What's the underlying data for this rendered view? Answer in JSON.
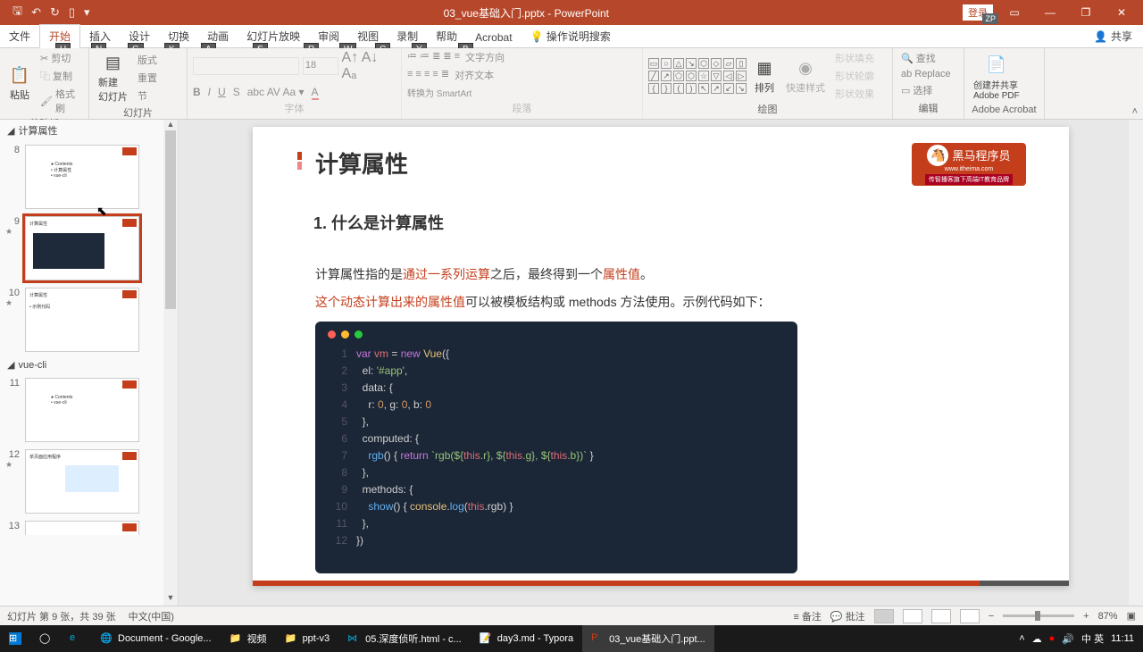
{
  "titlebar": {
    "title": "03_vue基础入门.pptx - PowerPoint",
    "login": "登录",
    "zp": "ZP"
  },
  "tabs": {
    "file": "文件",
    "home": "开始",
    "insert": "插入",
    "design": "设计",
    "transitions": "切换",
    "animations": "动画",
    "slideshow": "幻灯片放映",
    "review": "审阅",
    "view": "视图",
    "record": "录制",
    "help": "帮助",
    "acrobat": "Acrobat",
    "tellme": "操作说明搜索",
    "share": "共享"
  },
  "keytips": {
    "home": "H",
    "insert": "N",
    "design": "G",
    "transitions": "K",
    "animations": "A",
    "slideshow": "S",
    "review": "R",
    "view": "W",
    "record": "C",
    "help": "Y",
    "acrobat": "B"
  },
  "ribbon": {
    "clipboard": {
      "label": "剪贴板",
      "paste": "粘贴",
      "cut": "剪切",
      "copy": "复制",
      "format": "格式刷"
    },
    "slides": {
      "label": "幻灯片",
      "new": "新建\n幻灯片",
      "layout": "版式",
      "reset": "重置",
      "section": "节"
    },
    "font": {
      "label": "字体",
      "size": "18"
    },
    "paragraph": {
      "label": "段落",
      "textdir": "文字方向",
      "align": "对齐文本",
      "smartart": "转换为 SmartArt"
    },
    "drawing": {
      "label": "绘图",
      "arrange": "排列",
      "quick": "快速样式",
      "fill": "形状填充",
      "outline": "形状轮廓",
      "effects": "形状效果"
    },
    "editing": {
      "label": "编辑",
      "find": "查找",
      "replace": "Replace",
      "select": "选择"
    },
    "adobe": {
      "label": "Adobe Acrobat",
      "create": "创建并共享\nAdobe PDF"
    }
  },
  "sections": {
    "s1": "计算属性",
    "s2": "vue-cli"
  },
  "thumbs": [
    {
      "num": "8",
      "star": ""
    },
    {
      "num": "9",
      "star": "★"
    },
    {
      "num": "10",
      "star": "★"
    },
    {
      "num": "11",
      "star": ""
    },
    {
      "num": "12",
      "star": "★"
    },
    {
      "num": "13",
      "star": ""
    }
  ],
  "slide": {
    "title": "计算属性",
    "logo": "黑马程序员",
    "logo_url": "www.itheima.com",
    "logo_sub": "传智播客旗下高端IT教育品牌",
    "h2": "1. 什么是计算属性",
    "p1a": "计算属性指的是",
    "p1b": "通过一系列运算",
    "p1c": "之后，最终得到一个",
    "p1d": "属性值",
    "p1e": "。",
    "p2a": "这个动态计算出来的属性值",
    "p2b": "可以被模板结构或 methods 方法使用。示例代码如下：",
    "code": [
      "var vm = new Vue({",
      "  el: '#app',",
      "  data: {",
      "    r: 0, g: 0, b: 0",
      "  },",
      "  computed: {",
      "    rgb() { return `rgb(${this.r}, ${this.g}, ${this.b})` }",
      "  },",
      "  methods: {",
      "    show() { console.log(this.rgb) }",
      "  },",
      "})"
    ]
  },
  "status": {
    "slide": "幻灯片 第 9 张，共 39 张",
    "lang": "中文(中国)",
    "notes": "备注",
    "comments": "批注",
    "zoom": "87%"
  },
  "taskbar": {
    "items": [
      "Document - Google...",
      "视频",
      "ppt-v3",
      "05.深度侦听.html - c...",
      "day3.md - Typora",
      "03_vue基础入门.ppt..."
    ],
    "ime": "中 英",
    "time": "11:11"
  }
}
